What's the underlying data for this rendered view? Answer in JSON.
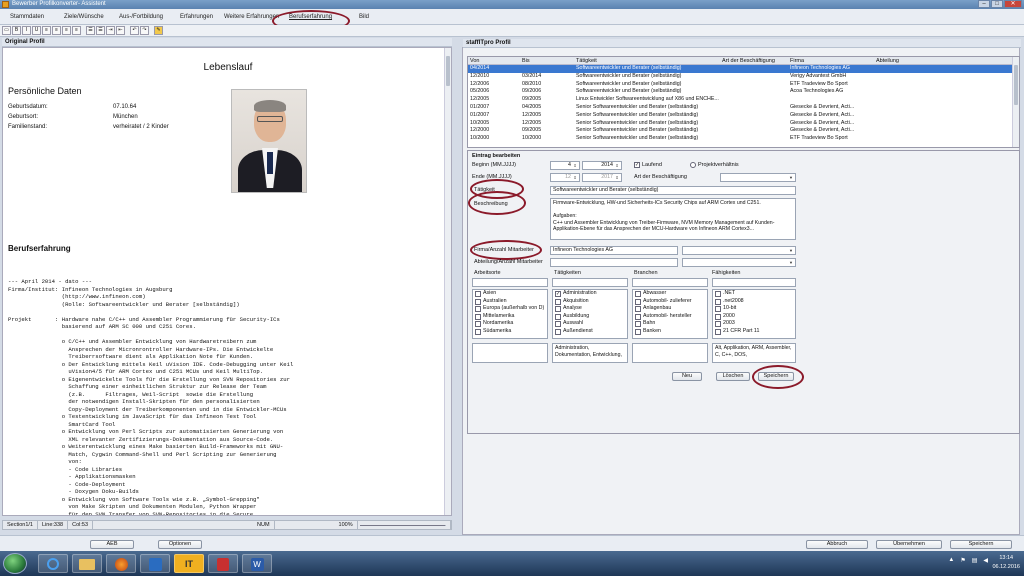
{
  "window": {
    "title": "Bewerber Profilkonverter- Assistent",
    "controls": [
      "–",
      "□",
      "✕"
    ]
  },
  "tabs": [
    "Stammdaten",
    "Ziele/Wünsche",
    "Aus-/Fortbildung",
    "Erfahrungen",
    "Weitere Erfahrungen",
    "Berufserfahrung",
    "Bild"
  ],
  "active_tab": "Berufserfahrung",
  "left_panel": {
    "title": "Original Profil",
    "heading": "Lebenslauf",
    "section": "Persönliche Daten",
    "fields": [
      {
        "label": "Geburtsdatum:",
        "value": "07.10.64"
      },
      {
        "label": "Geburtsort:",
        "value": "München"
      },
      {
        "label": "Familienstand:",
        "value": "verheiratet / 2 Kinder"
      }
    ],
    "berufs_heading": "Berufserfahrung",
    "lines": [
      "--- April 2014 - dato ---",
      "Firma/Institut: Infineon Technologies in Augsburg",
      "                (http://www.infineon.com)",
      "                (Rolle: Softwareentwickler und Berater [selbständig])",
      "",
      "Projekt       : Hardware nahe C/C++ und Assembler Programmierung für Security-ICs",
      "                basierend auf ARM SC 000 und C251 Cores.",
      "",
      "                o C/C++ und Assembler Entwicklung von Hardwaretreibern zum",
      "                  Ansprechen der Micronrontroller Hardware-IPs. Die Entwickelte",
      "                  Treiberrsoftware dient als Applikation Note für Kunden.",
      "                o Der Entwicklung mittels Keil uVision IDE. Code-Debugging unter Keil",
      "                  uVision4/5 für ARM Cortex und C251 MCUs und Keil MultiTop.",
      "                o Eigenentwickelte Tools für die Erstellung von SVN Repositories zur",
      "                  Schaffung einer einheitlichen Struktur zur Release der Team",
      "                  (z.B.      Filtrages, Weil-Script  sowie die Erstellung",
      "                  der notwendigen Install-Skripten für den personalisierten",
      "                  Copy-Deployment der Treiberkomponenten und in die Entwickler-MCUs",
      "                o Testentwicklung im JavaScript für das Infineon Test Tool",
      "                  SmartCard Tool",
      "                o Entwicklung von Perl Scripts zur automatisierten Generierung von",
      "                  XML relevanter Zertifizierungs-Dokumentation aus Source-Code.",
      "                o Weiterentwicklung eines Make basierten Build-Frameworks mit GNU-",
      "                  Match, Cygwin Command-Shell und Perl Scripting zur Generierung",
      "                  von:",
      "                  - Code Libraries",
      "                  - Applikationsmasken",
      "                  - Code-Deployment",
      "                  - Doxygen Doku-Builds",
      "                o Entwicklung von Software Tools wie z.B. „Symbol-Grepping\"",
      "                  von Make Skripten und Dokumenten Modulen, Python Wrapper",
      "                  für den SVN Transfer von SVN-Repositories in die Secure",
      "Software        Zone\".",
      "",
      "Softwaretools : Keil UV4/5 IDE mit ARM Cortex9 Emulator/Simulator, Hitex HitTop",
      "                Emulator für C251 MCUs, Keiltpe mit C51 Plugin,",
      "                Windows7/Cygwin (bash, g++, gcc, make, perl, etc.), Doxygen,",
      "                SVN & Tortoise-SVN, Infineon SmartCard-Manager, WinSCP, SSH Secsh,",
      "                Xming Player."
    ],
    "status": {
      "section": "Section1/1",
      "line": "Line:338",
      "col": "Col:53",
      "mode": "NUM",
      "zoom": "100%"
    }
  },
  "right_panel": {
    "title": "staffITpro Profil",
    "table": {
      "headers": [
        "Von",
        "Bis",
        "Tätigkeit",
        "Art der Beschäftigung",
        "Firma",
        "Abteilung"
      ],
      "rows": [
        [
          "04/2014",
          "",
          "Softwareentwickler und Berater (selbständig)",
          "",
          "Infineon Technologies AG",
          ""
        ],
        [
          "12/2010",
          "03/2014",
          "Softwareentwickler und Berater (selbständig)",
          "",
          "Verigy Advantest GmbH",
          ""
        ],
        [
          "12/2006",
          "08/2010",
          "Softwareentwickler und Berater (selbständig)",
          "",
          "ETF Tradeview Bo Sport",
          ""
        ],
        [
          "05/2006",
          "09/2006",
          "Softwareentwickler und Berater (selbständig)",
          "",
          "Acoa Technologies AG",
          ""
        ],
        [
          "12/2005",
          "09/2005",
          "Linux Entwickler Softwareentwicklung auf X86 und ENCHE...",
          "",
          "",
          ""
        ],
        [
          "01/2007",
          "04/2005",
          "Senior Softwareentwickler und Berater (selbständig)",
          "",
          "Giesecke & Devrient, Acti...",
          ""
        ],
        [
          "01/2007",
          "12/2005",
          "Senior Softwareentwickler und Berater (selbständig)",
          "",
          "Giesecke & Devrient, Acti...",
          ""
        ],
        [
          "10/2005",
          "12/2005",
          "Senior Softwareentwickler und Berater (selbständig)",
          "",
          "Giesecke & Devrient, Acti...",
          ""
        ],
        [
          "12/2000",
          "09/2005",
          "Senior Softwareentwickler und Berater (selbständig)",
          "",
          "Giesecke & Devrient, Acti...",
          ""
        ],
        [
          "10/2000",
          "10/2000",
          "Senior Softwareentwickler und Berater (selbständig)",
          "",
          "ETF Tradeview Bo Sport",
          ""
        ]
      ],
      "selected": 0
    },
    "edit": {
      "title": "Eintrag bearbeiten",
      "beginn_label": "Beginn (MM.JJJJ)",
      "beginn_month": "4",
      "beginn_year": "2014",
      "laufend": "Laufend",
      "projektverhaeltnis": "Projektverhältnis",
      "ende_label": "Ende (MM.JJJJ)",
      "ende_month": "12",
      "ende_year": "2017",
      "art_label": "Art der Beschäftigung",
      "art_value": "",
      "taetigkeit_label": "Tätigkeit",
      "taetigkeit_value": "Softwareentwickler und Berater (selbständig)",
      "beschreibung_label": "Beschreibung",
      "beschreibung_value": "Firmware-Entwicklung, HW-und Sicherheits-ICs Security Chips auf ARM Cortex und C251.\n\nAufgaben:\nC++ und Assembler Entwicklung von Treiber-Firmware, NVM Memory Management auf Kunden-Applikation-Ebene für das Ansprechen der MCU-Hardware von Infineon ARM Cortex3...",
      "firma_label": "Firma/Anzahl Mitarbeiter",
      "firma_value": "Infineon Technologies AG",
      "abteilung_label": "Abteilung/Anzahl Mitarbeiter",
      "col_headers": [
        "Arbeitsorte",
        "Tätigkeiten",
        "Branchen",
        "Fähigkeiten"
      ],
      "arbeitsorte": [
        "Asien",
        "Australien",
        "Europa (außerhalb von D)",
        "Mittelamerika",
        "Nordamerika",
        "Südamerika"
      ],
      "taetigkeiten": [
        "Administration",
        "Akquisition",
        "Analyse",
        "Ausbildung",
        "Auswahl",
        "Außendienst"
      ],
      "taetigkeiten_checked": [
        0
      ],
      "branchen": [
        "Abwasser",
        "Automobil- zulieferer",
        "Anlagenbau",
        "Automobil- hersteller",
        "Bahn",
        "Banken"
      ],
      "faehigkeiten": [
        ".NET",
        ".net2008",
        "10-bit",
        "2000",
        "2003",
        "21 CFR Part 11"
      ],
      "ta_text": "Administration, Dokumentation, Entwicklung,",
      "fa_text": "Alt, Applikation, ARM, Assembler, C, C++, DOS,",
      "buttons": {
        "neu": "Neu",
        "loeschen": "Löschen",
        "speichern": "Speichern"
      }
    }
  },
  "bottom": {
    "left_buttons": [
      "AEB",
      "Optionen"
    ],
    "right_buttons": [
      "Abbruch",
      "Übernehmen",
      "Speichern"
    ]
  },
  "taskbar": {
    "time": "13:14",
    "date": "06.12.2016",
    "apps": [
      "ie",
      "explorer",
      "firefox",
      "outlook",
      "it-app",
      "acrobat",
      "word"
    ]
  }
}
